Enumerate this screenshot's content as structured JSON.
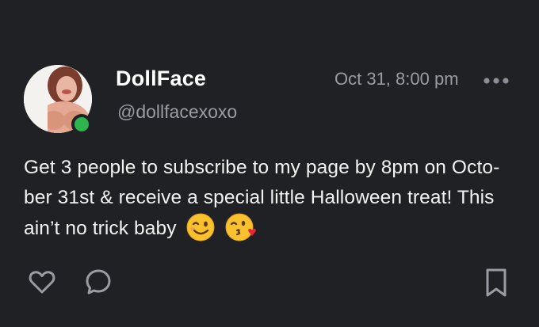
{
  "post": {
    "author_name": "DollFace",
    "author_handle": "@dollfacexoxo",
    "timestamp": "Oct 31, 8:00 pm",
    "text_line1": "Get 3 people to subscribe to my page by 8pm on Octo-",
    "text_line2": "ber 31st & receive a special little Halloween treat! This",
    "text_line3": "ain’t no trick baby",
    "emojis": [
      "winking-face",
      "face-blowing-kiss"
    ],
    "status": "online"
  },
  "actions": {
    "icons": [
      "heart-icon",
      "comment-icon",
      "bookmark-icon"
    ]
  },
  "colors": {
    "background": "#202124",
    "text": "#f2f2f2",
    "muted": "#9a9ca3",
    "online": "#2fb54f"
  }
}
